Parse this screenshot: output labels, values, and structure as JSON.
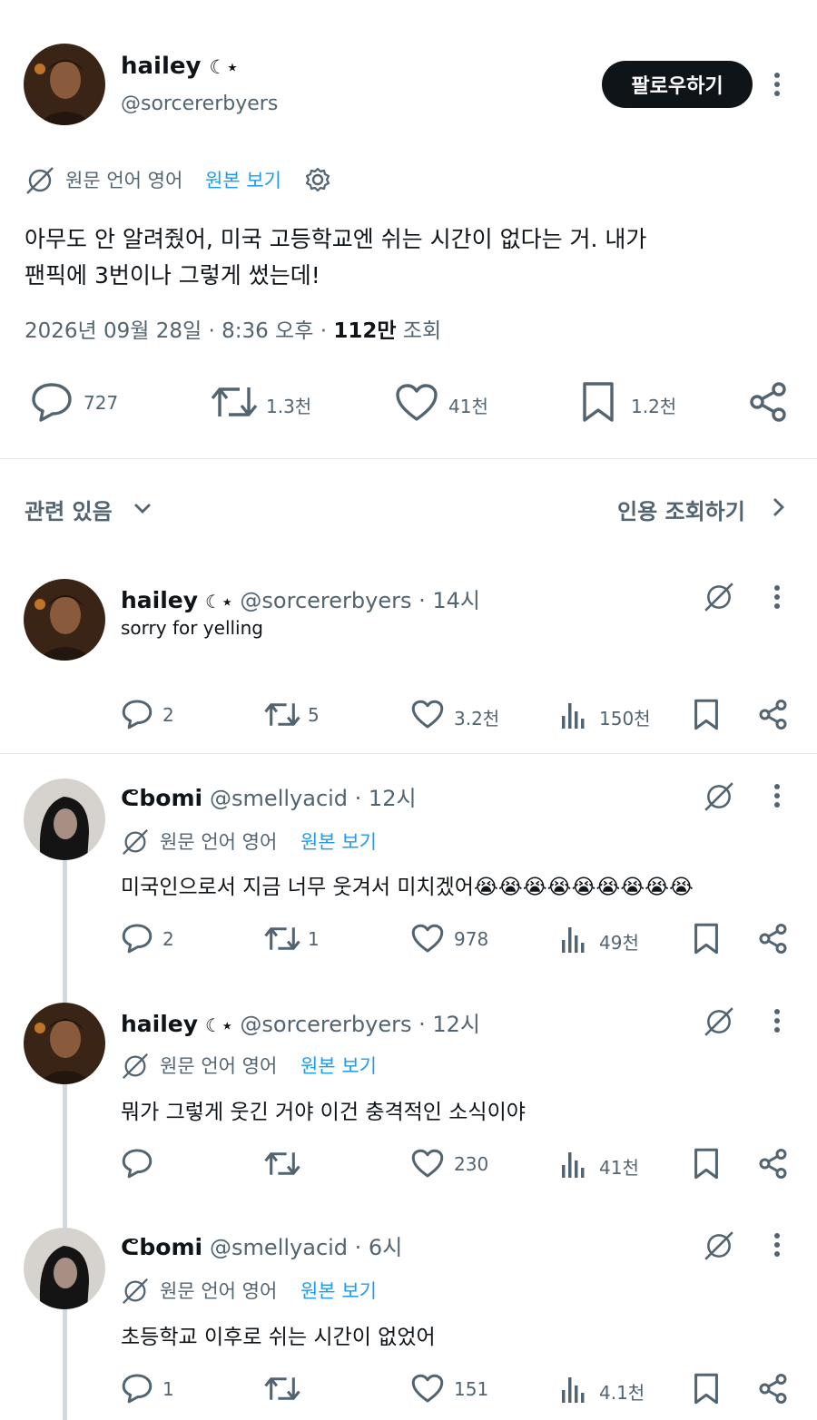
{
  "main_tweet": {
    "display_name": "hailey",
    "name_emoji": "☾⋆",
    "handle": "@sorcererbyers",
    "follow_label": "팔로우하기",
    "translation_label": "원문 언어 영어",
    "show_original_label": "원본 보기",
    "text_line1": "아무도 안 알려줬어, 미국 고등학교엔 쉬는 시간이 없다는 거. 내가",
    "text_line2": "팬픽에 3번이나 그렇게 썼는데!",
    "date": "2026년 09월 28일 · 8:36 오후 · ",
    "views_count": "112만",
    "views_label": " 조회",
    "reply_count": "727",
    "retweet_count": "1.3천",
    "like_count": "41천",
    "bookmark_count": "1.2천"
  },
  "related": {
    "label": "관련 있음",
    "quotes_label": "인용 조회하기"
  },
  "replies": [
    {
      "display_name": "hailey",
      "name_emoji": "☾⋆",
      "handle_time": "@sorcererbyers · 14시",
      "text": "sorry for yelling",
      "reply_count": "2",
      "retweet_count": "5",
      "like_count": "3.2천",
      "view_count": "150천"
    },
    {
      "display_name": "bomi",
      "name_prefix": "ᕦ",
      "handle_time": "@smellyacid · 12시",
      "translation_label": "원문 언어 영어",
      "show_original_label": "원본 보기",
      "text": "미국인으로서 지금 너무 웃겨서 미치겠어😭😭😭😭😭😭😭😭😭",
      "reply_count": "2",
      "retweet_count": "1",
      "like_count": "978",
      "view_count": "49천"
    },
    {
      "display_name": "hailey",
      "name_emoji": "☾⋆",
      "handle_time": "@sorcererbyers · 12시",
      "translation_label": "원문 언어 영어",
      "show_original_label": "원본 보기",
      "text": "뭐가 그렇게 웃긴 거야 이건 충격적인 소식이야",
      "like_count": "230",
      "view_count": "41천"
    },
    {
      "display_name": "bomi",
      "name_prefix": "ᕦ",
      "handle_time": "@smellyacid · 6시",
      "translation_label": "원문 언어 영어",
      "show_original_label": "원본 보기",
      "text": "초등학교 이후로 쉬는 시간이 없었어",
      "reply_count": "1",
      "like_count": "151",
      "view_count": "4.1천"
    }
  ],
  "colors": {
    "text": "#0f1419",
    "muted": "#536471",
    "link": "#1d9bf0",
    "button_bg": "#0f1419",
    "divider": "#e6e9ec",
    "thread_line": "#cfd9de"
  },
  "icons": [
    "reply-icon",
    "retweet-icon",
    "like-icon",
    "bookmark-icon",
    "share-icon",
    "views-icon",
    "translate-icon",
    "settings-icon",
    "more-icon",
    "chevron-down-icon",
    "chevron-right-icon"
  ]
}
